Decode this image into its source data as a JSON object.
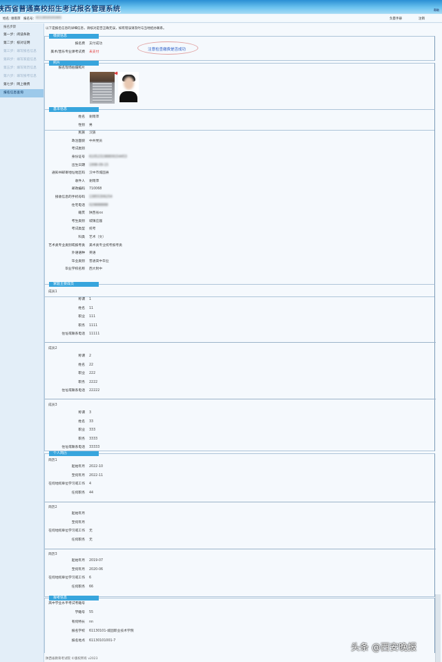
{
  "app_title": "陕西省普通高校招生考试报名管理系统",
  "banner_right": "帮助",
  "infobar": {
    "name_label": "姓名：",
    "name_value": "谢雨萍",
    "id_label": "报名号：",
    "id_value": "6113010101001",
    "help_text": "负量手册",
    "logout": "注销"
  },
  "sidebar": {
    "title": "报名步骤",
    "items": [
      {
        "label": "第一步：阅读条款"
      },
      {
        "label": "第二步：核对证明"
      },
      {
        "label": "第三步：填写报名信息"
      },
      {
        "label": "第四步：填写家庭信息"
      },
      {
        "label": "第五步：填写简历信息"
      },
      {
        "label": "第六步：填写报考信息"
      },
      {
        "label": "第七步：网上缴费"
      },
      {
        "label": "报名信息查询"
      }
    ]
  },
  "notice": "以下是报名信息的详细信息，请核对是否正确无误，如有错误请及时与当地招办联系。",
  "annotation": "注意检查缴费是否成功",
  "payment": {
    "title": "缴费信息",
    "rows": [
      {
        "label": "报名费",
        "value": "支付成功"
      },
      {
        "label": "美术/音乐专业课考试费",
        "value": "未支付"
      }
    ]
  },
  "photo": {
    "title": "照片",
    "label": "报名现场拍摄照片"
  },
  "basic": {
    "title": "基本信息",
    "rows": [
      {
        "label": "姓名",
        "value": "谢雨萍"
      },
      {
        "label": "性别",
        "value": "男"
      },
      {
        "label": "民族",
        "value": "汉族"
      },
      {
        "label": "政治面貌",
        "value": "中共党员"
      },
      {
        "label": "考试类别",
        "value": ""
      },
      {
        "label": "身份证号",
        "value": "610523198809154453"
      },
      {
        "label": "出生日期",
        "value": "1998-09-15"
      },
      {
        "label": "通知书邮寄地址地区码",
        "value": "汉中市城固县"
      },
      {
        "label": "收件人",
        "value": "谢雨萍"
      },
      {
        "label": "邮政编码",
        "value": "710068"
      },
      {
        "label": "接收信息的手机号码",
        "value": "13855306254"
      },
      {
        "label": "住宅电话",
        "value": "029888888"
      },
      {
        "label": "籍贯",
        "value": "陕西省xx"
      },
      {
        "label": "考生类别",
        "value": "城镇应届"
      },
      {
        "label": "考试类型",
        "value": "统考"
      },
      {
        "label": "科类",
        "value": "艺术（文）"
      },
      {
        "label": "艺术类专业类别或报考类",
        "value": "美术类专业统考报考类"
      },
      {
        "label": "外语语种",
        "value": "英语"
      },
      {
        "label": "毕业类别",
        "value": "普通高中毕业"
      },
      {
        "label": "毕业学校名称",
        "value": "西大附中"
      }
    ]
  },
  "family": {
    "title": "家庭主要成员",
    "members": [
      {
        "heading": "成员1",
        "rows": [
          {
            "label": "称谓",
            "value": "1"
          },
          {
            "label": "姓名",
            "value": "11"
          },
          {
            "label": "职业",
            "value": "111"
          },
          {
            "label": "职务",
            "value": "1111"
          },
          {
            "label": "住址或联系电话",
            "value": "11111"
          }
        ]
      },
      {
        "heading": "成员2",
        "rows": [
          {
            "label": "称谓",
            "value": "2"
          },
          {
            "label": "姓名",
            "value": "22"
          },
          {
            "label": "职业",
            "value": "222"
          },
          {
            "label": "职务",
            "value": "2222"
          },
          {
            "label": "住址或联系电话",
            "value": "22222"
          }
        ]
      },
      {
        "heading": "成员3",
        "rows": [
          {
            "label": "称谓",
            "value": "3"
          },
          {
            "label": "姓名",
            "value": "33"
          },
          {
            "label": "职业",
            "value": "333"
          },
          {
            "label": "职务",
            "value": "3333"
          },
          {
            "label": "住址或联系电话",
            "value": "33333"
          }
        ]
      }
    ]
  },
  "resume": {
    "title": "个人简历",
    "entries": [
      {
        "heading": "简历1",
        "rows": [
          {
            "label": "起始年月",
            "value": "2022-10"
          },
          {
            "label": "至何年月",
            "value": "2022-11"
          },
          {
            "label": "在何地何单位学习或工作",
            "value": "4"
          },
          {
            "label": "任何职务",
            "value": "44"
          }
        ]
      },
      {
        "heading": "简历2",
        "rows": [
          {
            "label": "起始年月",
            "value": ""
          },
          {
            "label": "至何年月",
            "value": ""
          },
          {
            "label": "在何地何单位学习或工作",
            "value": "无"
          },
          {
            "label": "任何职务",
            "value": "无"
          }
        ]
      },
      {
        "heading": "简历3",
        "rows": [
          {
            "label": "起始年月",
            "value": "2019-07"
          },
          {
            "label": "至何年月",
            "value": "2020-06"
          },
          {
            "label": "在何地何单位学习或工作",
            "value": "6"
          },
          {
            "label": "任何职务",
            "value": "66"
          }
        ]
      }
    ]
  },
  "exam": {
    "title": "报考信息",
    "rows": [
      {
        "label": "高中学业水平考试考籍号",
        "value": ""
      },
      {
        "label": "学籍号",
        "value": "55"
      },
      {
        "label": "有何特长",
        "value": "nn"
      },
      {
        "label": "报名学校",
        "value": "61130101-城固职业技术学院"
      },
      {
        "label": "报名地点",
        "value": "61130101001-7"
      }
    ]
  },
  "footer": "陕西省教育考试院 ©版权所有 v2023",
  "watermark": "头条 @西安晚报"
}
